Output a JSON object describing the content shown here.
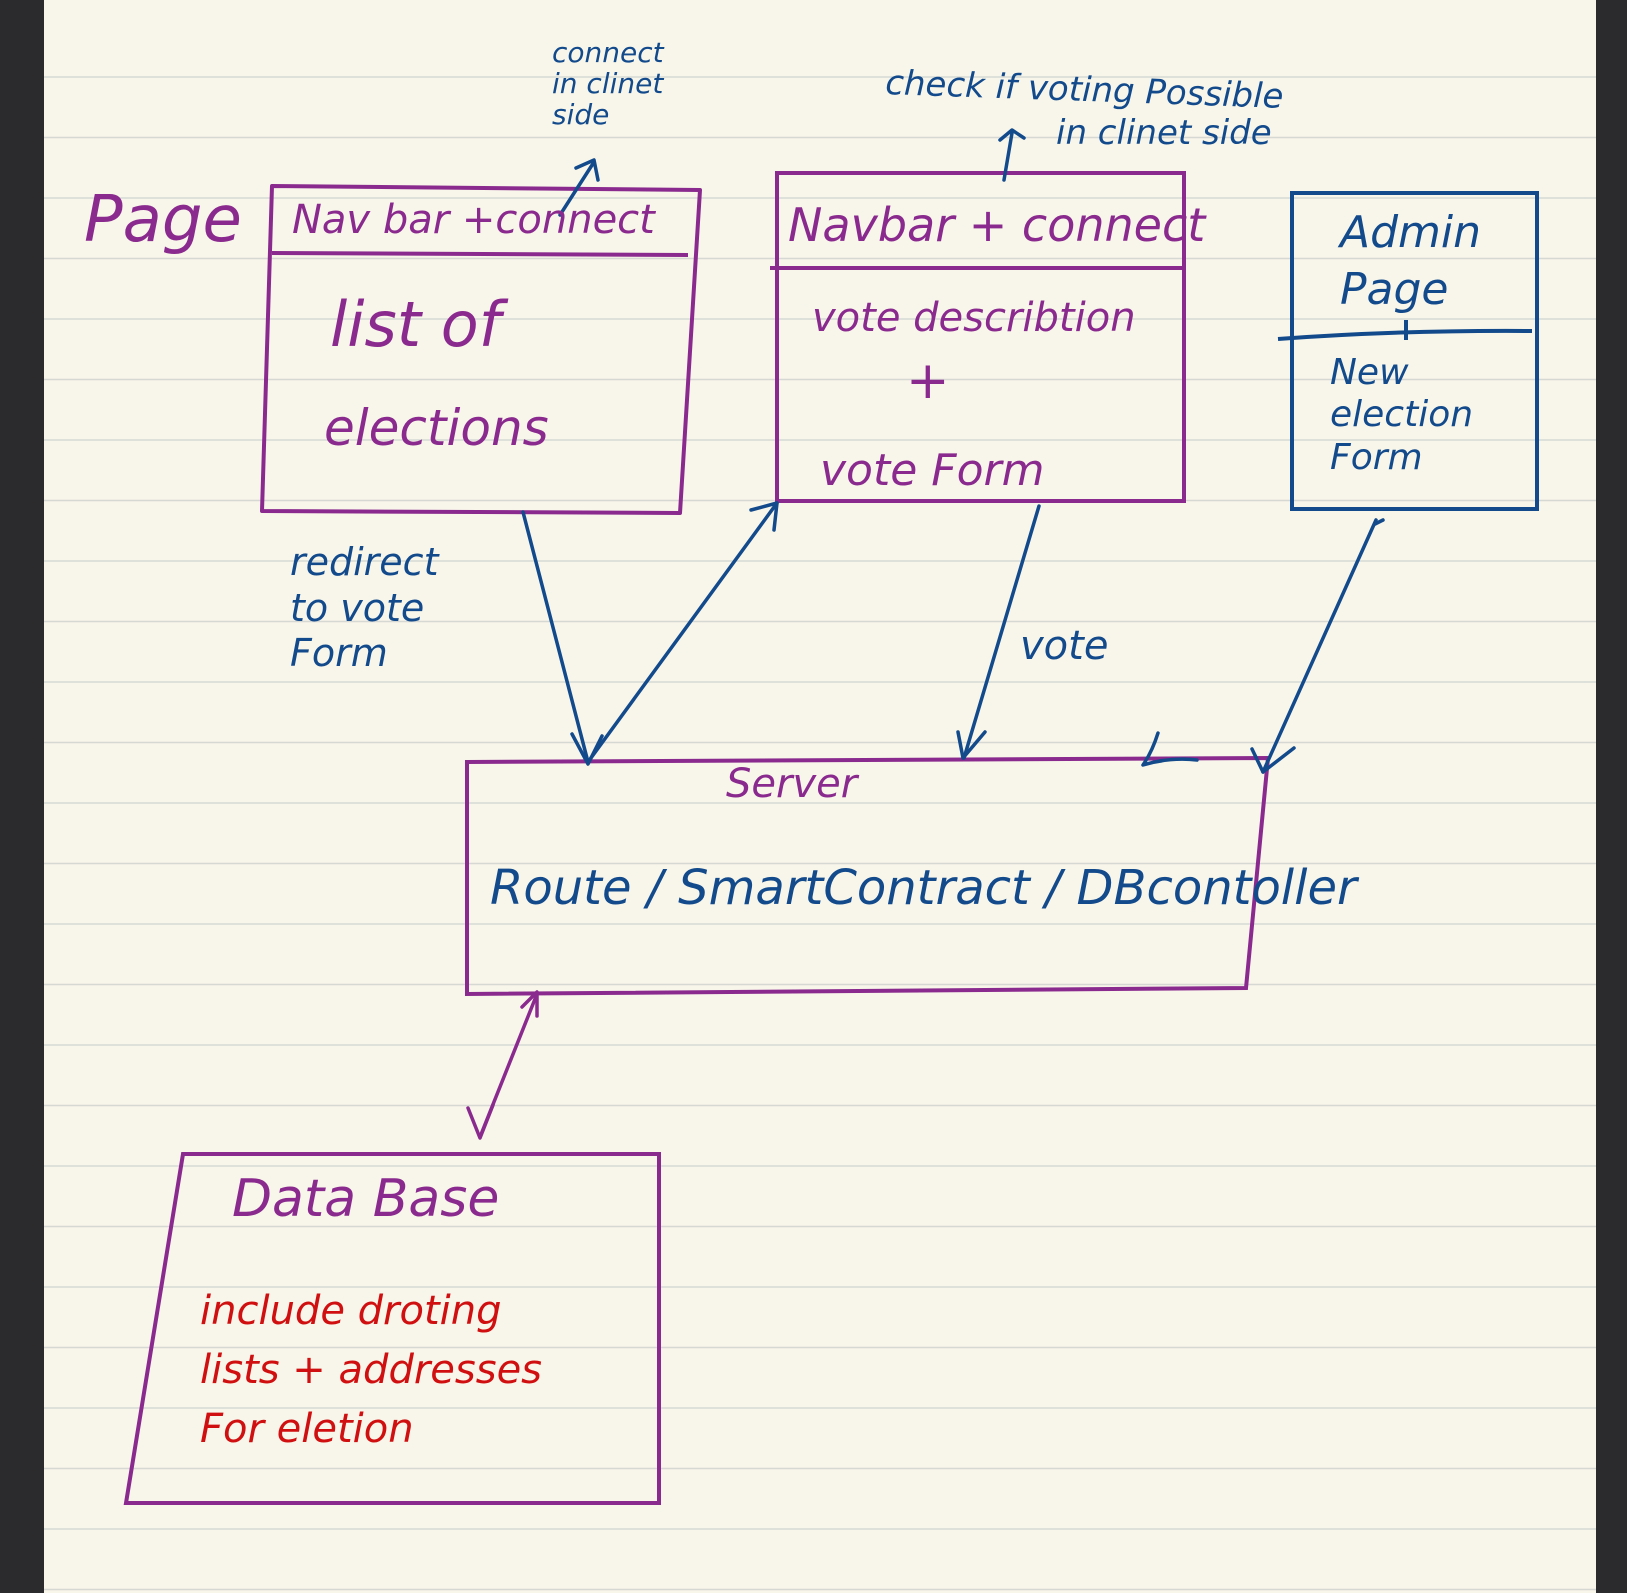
{
  "colors": {
    "paper": "#f8f6ea",
    "rule": "#d6d8d4",
    "margin": "#2b2b2d",
    "purple": "#8a2a8e",
    "blue": "#124a8c",
    "red": "#d01010"
  },
  "page_label": "Page",
  "note_connect": "connect\nin clinet\nside",
  "note_check": "check if voting Possible",
  "note_check_side": "in clinet side",
  "box_elections": {
    "header": "Nav bar +connect",
    "body_line1": "list of",
    "body_line2": "elections"
  },
  "box_vote": {
    "header": "Navbar + connect",
    "body_line1": "vote describtion",
    "body_line2": "+",
    "body_line3": "vote Form"
  },
  "box_admin": {
    "title": "Admin\nPage",
    "body": "New\nelection\nForm"
  },
  "redirect_note": "redirect\nto vote\nForm",
  "vote_label": "vote",
  "server": {
    "title": "Server",
    "body": "Route / SmartContract / DBcontoller"
  },
  "database": {
    "title": "Data Base",
    "body": "include droting\nlists + addresses\nFor eletion"
  }
}
